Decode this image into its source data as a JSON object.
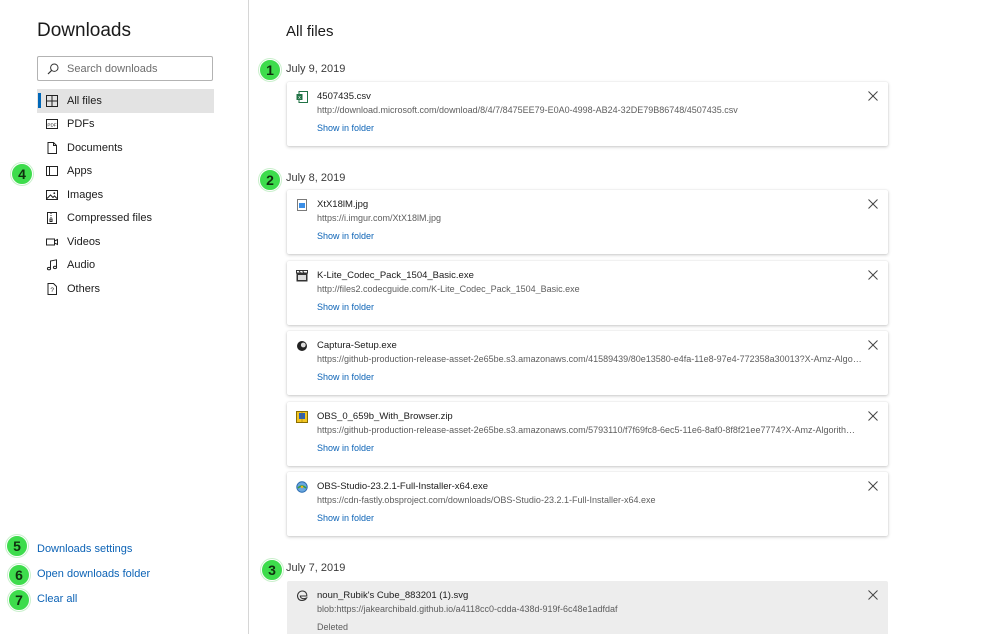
{
  "sidebar": {
    "title": "Downloads",
    "search_placeholder": "Search downloads",
    "items": [
      {
        "label": "All files",
        "icon": "grid-icon",
        "active": true
      },
      {
        "label": "PDFs",
        "icon": "pdf-icon"
      },
      {
        "label": "Documents",
        "icon": "document-icon"
      },
      {
        "label": "Apps",
        "icon": "app-window-icon"
      },
      {
        "label": "Images",
        "icon": "image-icon"
      },
      {
        "label": "Compressed files",
        "icon": "zip-icon"
      },
      {
        "label": "Videos",
        "icon": "video-icon"
      },
      {
        "label": "Audio",
        "icon": "music-note-icon"
      },
      {
        "label": "Others",
        "icon": "question-icon"
      }
    ],
    "footer": {
      "settings": "Downloads settings",
      "open_folder": "Open downloads folder",
      "clear_all": "Clear all"
    }
  },
  "badges": [
    "1",
    "2",
    "3",
    "4",
    "5",
    "6",
    "7"
  ],
  "main": {
    "title": "All files",
    "groups": [
      {
        "date": "July 9, 2019",
        "items": [
          {
            "name": "4507435.csv",
            "url": "http://download.microsoft.com/download/8/4/7/8475EE79-E0A0-4998-AB24-32DE79B86748/4507435.csv",
            "action": "Show in folder",
            "icon": "excel-csv-icon"
          }
        ]
      },
      {
        "date": "July 8, 2019",
        "items": [
          {
            "name": "XtX18lM.jpg",
            "url": "https://i.imgur.com/XtX18lM.jpg",
            "action": "Show in folder",
            "icon": "image-file-icon"
          },
          {
            "name": "K-Lite_Codec_Pack_1504_Basic.exe",
            "url": "http://files2.codecguide.com/K-Lite_Codec_Pack_1504_Basic.exe",
            "action": "Show in folder",
            "icon": "film-clapper-icon"
          },
          {
            "name": "Captura-Setup.exe",
            "url": "https://github-production-release-asset-2e65be.s3.amazonaws.com/41589439/80e13580-e4fa-11e8-97e4-772358a30013?X-Amz-Algorithm...",
            "action": "Show in folder",
            "icon": "captura-icon"
          },
          {
            "name": "OBS_0_659b_With_Browser.zip",
            "url": "https://github-production-release-asset-2e65be.s3.amazonaws.com/5793110/f7f69fc8-6ec5-11e6-8af0-8f8f21ee7774?X-Amz-Algorithm=...",
            "action": "Show in folder",
            "icon": "zip-archive-icon"
          },
          {
            "name": "OBS-Studio-23.2.1-Full-Installer-x64.exe",
            "url": "https://cdn-fastly.obsproject.com/downloads/OBS-Studio-23.2.1-Full-Installer-x64.exe",
            "action": "Show in folder",
            "icon": "installer-icon"
          }
        ]
      },
      {
        "date": "July 7, 2019",
        "items": [
          {
            "name": "noun_Rubik's Cube_883201 (1).svg",
            "url": "blob:https://jakearchibald.github.io/a4118cc0-cdda-438d-919f-6c48e1adfdaf",
            "action": "Deleted",
            "icon": "edge-file-icon",
            "deleted": true
          }
        ]
      }
    ]
  },
  "colors": {
    "accent": "#0067b8",
    "link": "#0c63b6",
    "badge": "#3ddc4c",
    "active_bg": "#e3e3e3"
  }
}
